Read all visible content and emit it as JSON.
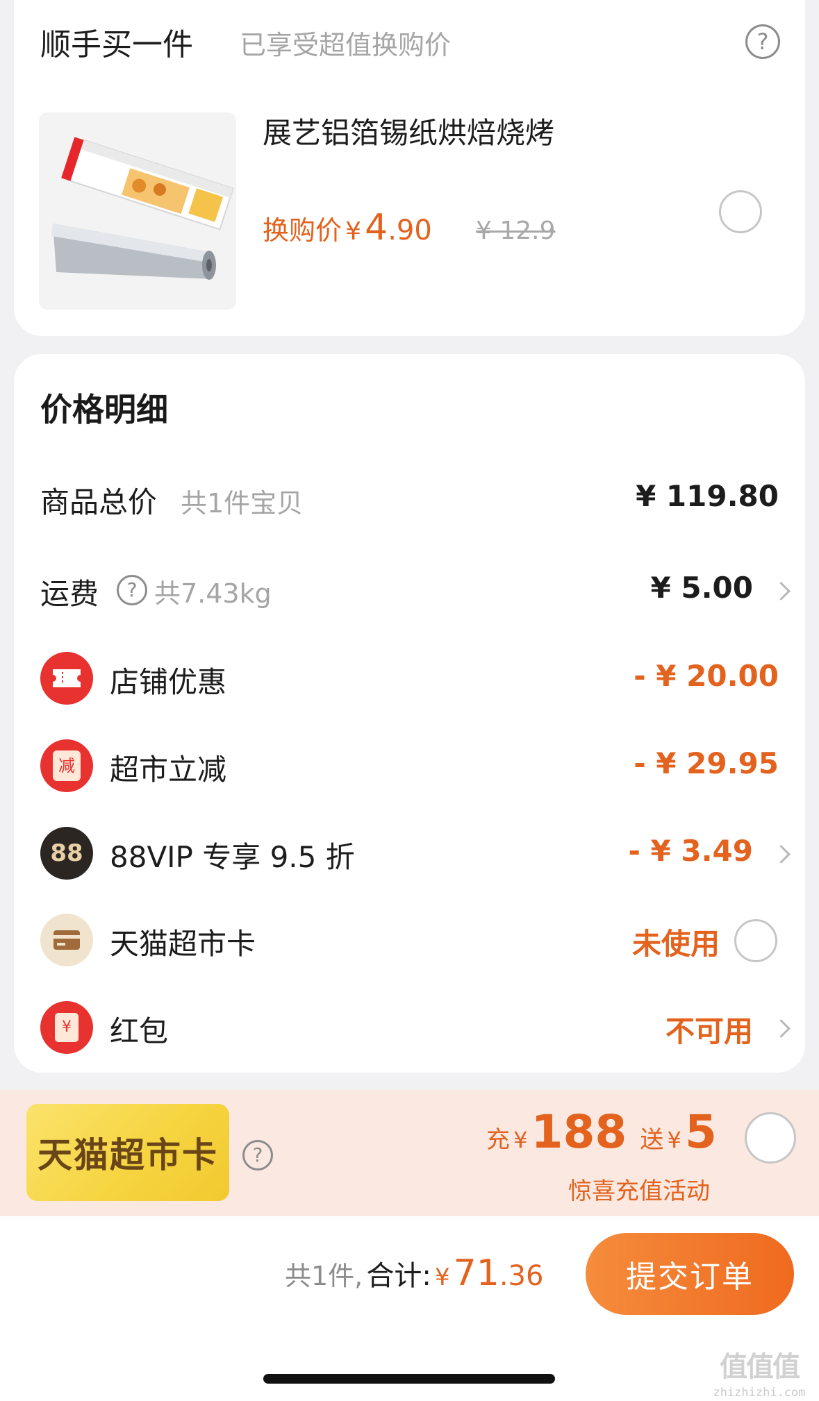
{
  "addon": {
    "title": "顺手买一件",
    "subtitle": "已享受超值换购价",
    "product": {
      "name": "展艺铝箔锡纸烘焙烧烤",
      "price_label": "换购价",
      "currency": "¥",
      "price_int": "4",
      "price_dec": ".90",
      "original_price": "¥ 12.9"
    }
  },
  "details": {
    "title": "价格明细",
    "rows": [
      {
        "label": "商品总价",
        "sub": "共1件宝贝",
        "amount": "¥ 119.80"
      },
      {
        "label": "运费",
        "sub": "共7.43kg",
        "amount": "¥ 5.00"
      },
      {
        "label": "店铺优惠",
        "icon": "ticket-icon",
        "amount": "- ¥ 20.00"
      },
      {
        "label": "超市立减",
        "icon": "discount-icon",
        "icon_text": "减",
        "amount": "- ¥ 29.95"
      },
      {
        "label": "88VIP 专享 9.5 折",
        "icon": "vip88-icon",
        "icon_text": "88",
        "amount": "- ¥ 3.49"
      },
      {
        "label": "天猫超市卡",
        "icon": "card-icon",
        "amount": "未使用"
      },
      {
        "label": "红包",
        "icon": "red-packet-icon",
        "icon_text": "¥",
        "amount": "不可用"
      }
    ]
  },
  "promo": {
    "badge": "天猫超市卡",
    "charge_label": "充",
    "charge_currency": "¥",
    "charge_amount": "188",
    "gift_label": "送",
    "gift_currency": "¥",
    "gift_amount": "5",
    "caption": "惊喜充值活动"
  },
  "footer": {
    "count": "共1件,",
    "total_label": "合计:",
    "currency": "¥",
    "total_int": "71",
    "total_dec": ".36",
    "submit": "提交订单"
  },
  "watermark": {
    "logo": "值值值",
    "site": "zhizhizhi.com"
  },
  "colors": {
    "accent": "#e2621e",
    "red_icon": "#e8322f",
    "vip_icon": "#2b2622",
    "card_icon": "#f1e4cf"
  }
}
